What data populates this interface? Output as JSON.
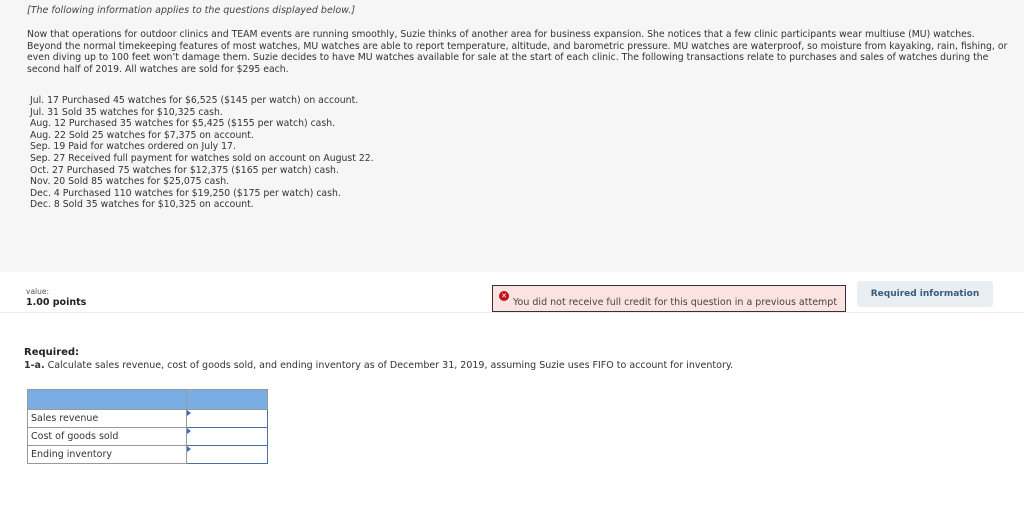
{
  "info": {
    "intro": "[The following information applies to the questions displayed below.]",
    "paragraph": "Now that operations for outdoor clinics and TEAM events are running smoothly, Suzie thinks of another area for business expansion. She notices that a few clinic participants wear multiuse (MU) watches. Beyond the normal timekeeping features of most watches, MU watches are able to report temperature, altitude, and barometric pressure. MU watches are waterproof, so moisture from kayaking, rain, fishing, or even diving up to 100 feet won’t damage them. Suzie decides to have MU watches available for sale at the start of each clinic. The following transactions relate to purchases and sales of watches during the second half of 2019. All watches are sold for $295 each.",
    "transactions": [
      "Jul. 17 Purchased 45 watches for $6,525 ($145 per watch) on account.",
      "Jul. 31 Sold 35 watches for $10,325 cash.",
      "Aug. 12 Purchased 35 watches for $5,425 ($155 per watch) cash.",
      "Aug. 22 Sold 25 watches for $7,375 on account.",
      "Sep. 19 Paid for watches ordered on July 17.",
      "Sep. 27 Received full payment for watches sold on account on August 22.",
      "Oct. 27 Purchased 75 watches for $12,375 ($165 per watch) cash.",
      "Nov. 20 Sold 85 watches for $25,075 cash.",
      "Dec. 4 Purchased 110 watches for $19,250 ($175 per watch) cash.",
      "Dec. 8 Sold 35 watches for $10,325 on account."
    ]
  },
  "question": {
    "value_label": "value:",
    "points": "1.00 points",
    "warning": "You did not receive full credit for this question in a previous attempt",
    "required_info_button": "Required information",
    "required_label": "Required:",
    "part_label": "1-a.",
    "part_text": " Calculate sales revenue, cost of goods sold, and ending inventory as of December 31, 2019, assuming Suzie uses FIFO to account for inventory."
  },
  "table": {
    "rows": [
      {
        "label": "Sales revenue",
        "value": ""
      },
      {
        "label": "Cost of goods sold",
        "value": ""
      },
      {
        "label": "Ending inventory",
        "value": ""
      }
    ]
  },
  "colors": {
    "header": "#7aade4",
    "warning_bg": "#fde2e2",
    "error": "#c0141e"
  }
}
